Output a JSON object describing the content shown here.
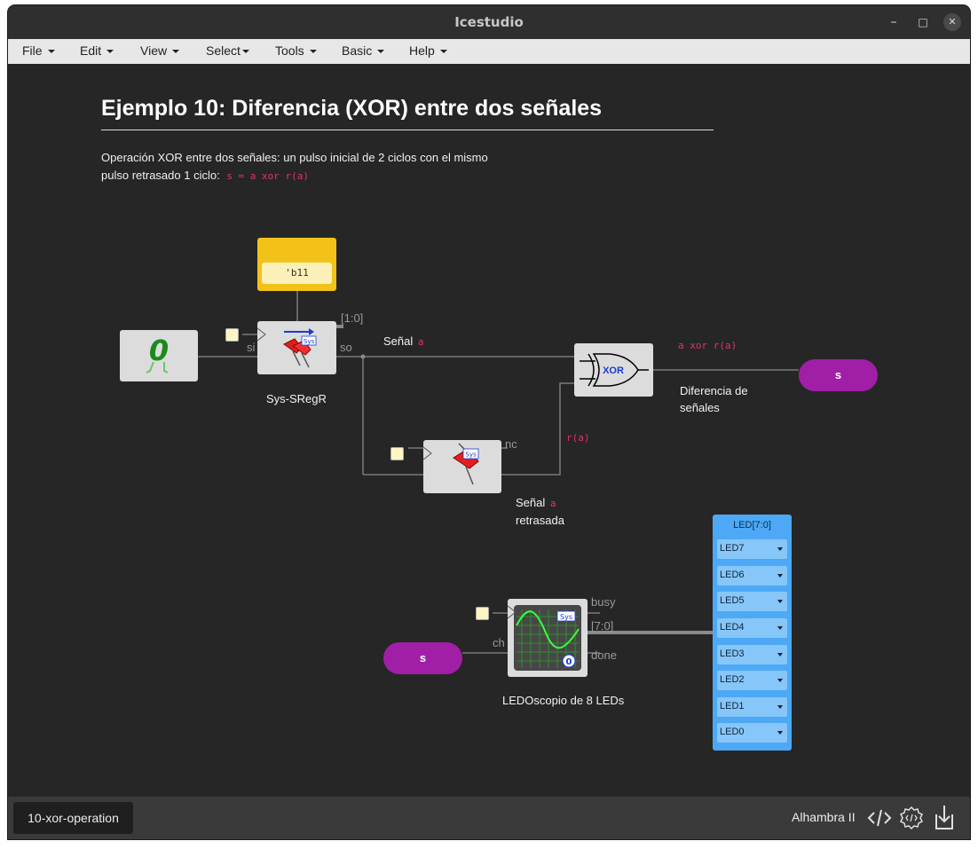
{
  "window": {
    "title": "Icestudio",
    "minimize": "–",
    "maximize": "□",
    "close": "✕"
  },
  "menu": {
    "items": [
      "File",
      "Edit",
      "View",
      "Select",
      "Tools",
      "Basic",
      "Help"
    ]
  },
  "doc": {
    "heading": "Ejemplo 10: Diferencia (XOR) entre dos señales",
    "desc_line1": "Operación XOR entre dos señales: un pulso inicial de 2 ciclos con el mismo",
    "desc_line2": "pulso retrasado 1 ciclo:",
    "desc_code": "s = a xor r(a)"
  },
  "circuit": {
    "const_value": "'b11",
    "sregr_label": "Sys-SRegR",
    "port_si": "si",
    "port_so": "so",
    "port_range": "[1:0]",
    "signal_a_label": "Señal",
    "signal_a_code": "a",
    "xor_label": "XOR",
    "xor_out_code": "a xor r(a)",
    "diff_label_1": "Diferencia de",
    "diff_label_2": "señales",
    "output_s": "s",
    "port_nc": "nc",
    "ra_code": "r(a)",
    "delayed_label_1": "Señal",
    "delayed_code": "a",
    "delayed_label_2": "retrasada",
    "sys_tag": "Sys",
    "input_s": "s",
    "port_ch": "ch",
    "port_busy": "busy",
    "port_bus": "[7:0]",
    "port_done": "done",
    "scope_count": "0",
    "scope_label": "LEDOscopio de 8 LEDs",
    "led_title": "LED[7:0]",
    "leds": [
      "LED7",
      "LED6",
      "LED5",
      "LED4",
      "LED3",
      "LED2",
      "LED1",
      "LED0"
    ]
  },
  "bottom": {
    "tab": "10-xor-operation",
    "board": "Alhambra II"
  },
  "colors": {
    "accent_purple": "#a11fa7",
    "const_yellow": "#f3c219",
    "led_blue": "#4da9f5",
    "code_red": "#e0336a"
  }
}
